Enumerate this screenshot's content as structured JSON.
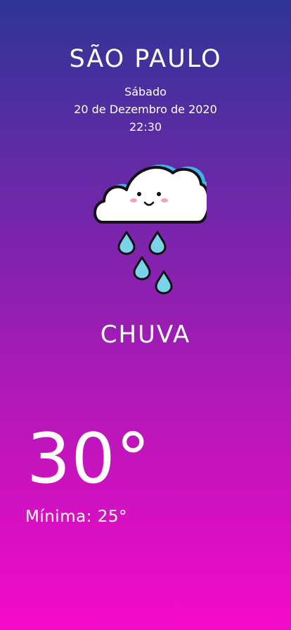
{
  "location": {
    "city": "SÃO PAULO"
  },
  "datetime": {
    "weekday": "Sábado",
    "date": "20 de Dezembro de 2020",
    "time": "22:30"
  },
  "weather": {
    "icon": "rain-cloud-icon",
    "condition": "CHUVA",
    "temperature": "30°",
    "minimum_label": "Mínima: 25°"
  },
  "colors": {
    "gradient_top": "#2e3596",
    "gradient_bottom": "#f50ac9",
    "raindrop": "#7ad3e8",
    "cloud_outline": "#111111",
    "cloud_shadow": "#3fb3ea"
  }
}
